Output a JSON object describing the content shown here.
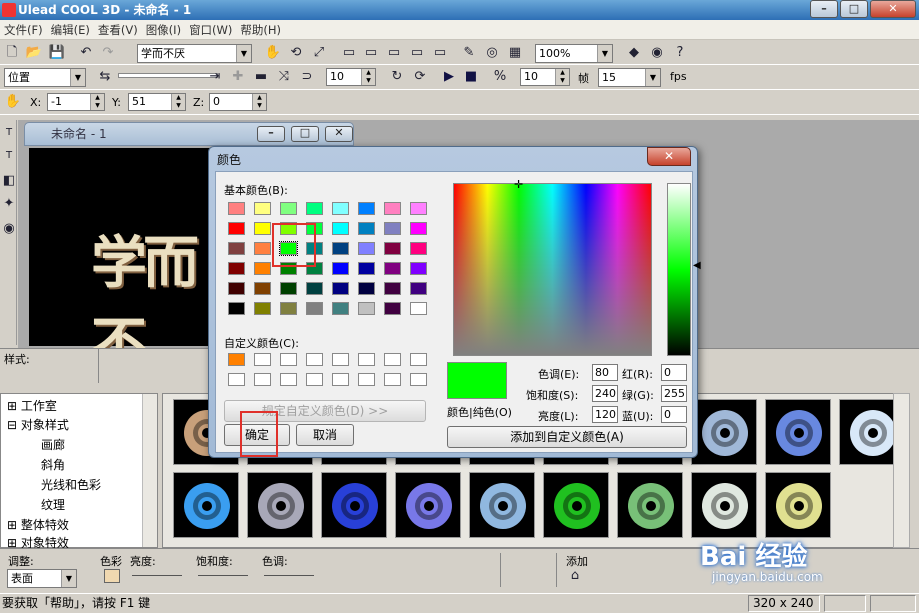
{
  "app": {
    "title": "Ulead COOL 3D - 未命名 - 1"
  },
  "menu": [
    "文件(F)",
    "编辑(E)",
    "查看(V)",
    "图像(I)",
    "窗口(W)",
    "帮助(H)"
  ],
  "toolbar1": {
    "font_combo": "学而不厌",
    "zoom_combo": "100%"
  },
  "toolbar2": {
    "mode_combo": "位置",
    "frame_value": "10",
    "fps_frame": "10",
    "fps_value": "15",
    "frame_label": "帧",
    "fps_label": "fps"
  },
  "toolbar3": {
    "x_label": "X:",
    "x_value": "-1",
    "y_label": "Y:",
    "y_value": "51",
    "z_label": "Z:",
    "z_value": "0"
  },
  "document": {
    "title": "未命名 - 1",
    "canvas_text": "学而不"
  },
  "style_label": "样式:",
  "tree": {
    "items": [
      "工作室",
      "对象样式",
      "画廊",
      "斜角",
      "光线和色彩",
      "纹理",
      "整体特效",
      "对象特效"
    ]
  },
  "bottom": {
    "adjust_label": "调整:",
    "surface_combo": "表面",
    "color_label": "色彩",
    "brightness_label": "亮度:",
    "saturation_label": "饱和度:",
    "hue_label": "色调:",
    "add_label": "添加"
  },
  "status": {
    "help_text": "要获取「帮助」，请按 F1 键",
    "size_text": "320 x 240"
  },
  "dialog": {
    "title": "颜色",
    "basic_colors_label": "基本颜色(B):",
    "custom_colors_label": "自定义颜色(C):",
    "define_button": "规定自定义颜色(D) >>",
    "ok_button": "确定",
    "cancel_button": "取消",
    "add_custom_button": "添加到自定义颜色(A)",
    "color_solid_label": "颜色|纯色(O)",
    "hue_label": "色调(E):",
    "hue_value": "80",
    "sat_label": "饱和度(S):",
    "sat_value": "240",
    "lum_label": "亮度(L):",
    "lum_value": "120",
    "red_label": "红(R):",
    "red_value": "0",
    "green_label": "绿(G):",
    "green_value": "255",
    "blue_label": "蓝(U):",
    "blue_value": "0",
    "preview_color": "#00ff00",
    "basic_colors": [
      [
        "#ff8080",
        "#ffff80",
        "#80ff80",
        "#00ff80",
        "#80ffff",
        "#0080ff",
        "#ff80c0",
        "#ff80ff"
      ],
      [
        "#ff0000",
        "#ffff00",
        "#80ff00",
        "#00ff40",
        "#00ffff",
        "#0080c0",
        "#8080c0",
        "#ff00ff"
      ],
      [
        "#804040",
        "#ff8040",
        "#00ff00",
        "#008080",
        "#004080",
        "#8080ff",
        "#800040",
        "#ff0080"
      ],
      [
        "#800000",
        "#ff8000",
        "#008000",
        "#008040",
        "#0000ff",
        "#0000a0",
        "#800080",
        "#8000ff"
      ],
      [
        "#400000",
        "#804000",
        "#004000",
        "#004040",
        "#000080",
        "#000040",
        "#400040",
        "#400080"
      ],
      [
        "#000000",
        "#808000",
        "#808040",
        "#808080",
        "#408080",
        "#c0c0c0",
        "#400040",
        "#ffffff"
      ]
    ]
  },
  "gallery": {
    "row1_colors": [
      "#c8a07a",
      "#b0b0b0",
      "#8898b8",
      "#a0a8d0",
      "#a8c0d8",
      "#8090b0",
      "#909090",
      "#a0b8d8",
      "#6888e0",
      "#d8e8f8"
    ],
    "row2_colors": [
      "#3a9ef0",
      "#a8a8b8",
      "#2840d8",
      "#7878e8",
      "#90b8e0",
      "#20c020",
      "#78c078",
      "#e0e8e0",
      "#e0e090"
    ]
  },
  "watermark": {
    "logo": "Bai 经验",
    "url": "jingyan.baidu.com"
  }
}
